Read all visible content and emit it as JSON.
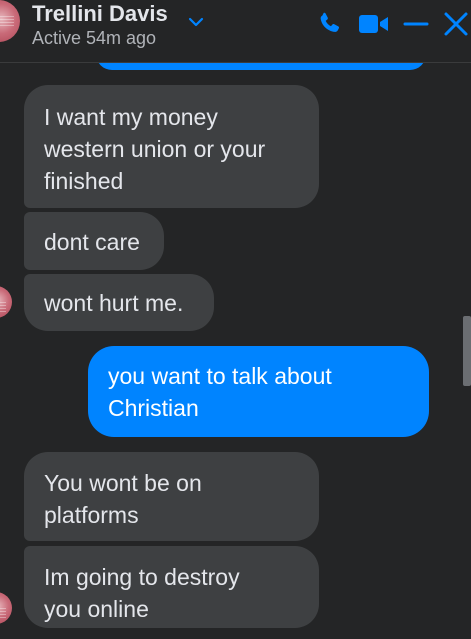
{
  "header": {
    "name": "Trellini Davis",
    "status": "Active 54m ago",
    "icons": [
      "chevron-down-icon",
      "phone-icon",
      "video-camera-icon",
      "minimize-icon",
      "close-icon"
    ],
    "accent_color": "#0084ff"
  },
  "messages": [
    {
      "direction": "incoming",
      "text": "I want my money\nwestern union or your\nfinished"
    },
    {
      "direction": "incoming",
      "text": "dont care"
    },
    {
      "direction": "incoming",
      "text": "wont hurt me."
    },
    {
      "direction": "outgoing",
      "text": "you want to talk about\nChristian"
    },
    {
      "direction": "incoming",
      "text": "You wont be on\nplatforms"
    },
    {
      "direction": "incoming",
      "text": "Im going to destroy\nyou online"
    }
  ],
  "colors": {
    "background": "#242526",
    "incoming_bubble": "#3e4042",
    "outgoing_bubble": "#0084ff",
    "text": "#e4e6eb",
    "secondary_text": "#b0b3b8"
  }
}
